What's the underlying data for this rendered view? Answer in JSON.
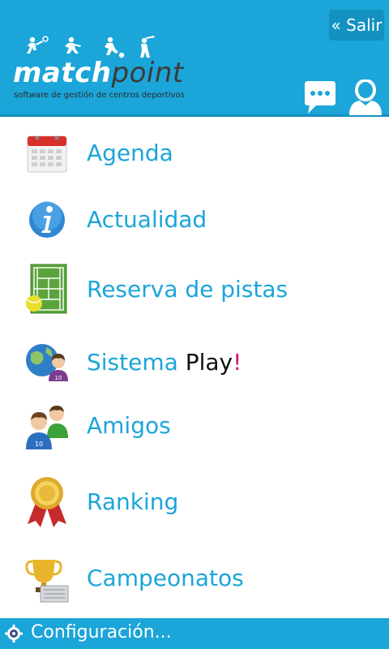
{
  "header": {
    "exit_label": "« Salir",
    "logo_match": "match",
    "logo_point": "point",
    "logo_tagline": "software de gestión de centros deportivos",
    "brand_color": "#1ba5d8"
  },
  "menu": {
    "items": [
      {
        "label": "Agenda",
        "icon": "calendar-icon"
      },
      {
        "label": "Actualidad",
        "icon": "info-icon"
      },
      {
        "label": "Reserva de pistas",
        "icon": "tennis-court-icon"
      },
      {
        "label_part1": "Sistema ",
        "label_part2": "Play",
        "label_part3": "!",
        "icon": "globe-user-icon"
      },
      {
        "label": "Amigos",
        "icon": "friends-icon"
      },
      {
        "label": "Ranking",
        "icon": "medal-icon"
      },
      {
        "label": "Campeonatos",
        "icon": "trophy-icon"
      }
    ]
  },
  "footer": {
    "settings_label": "Configuración..."
  }
}
